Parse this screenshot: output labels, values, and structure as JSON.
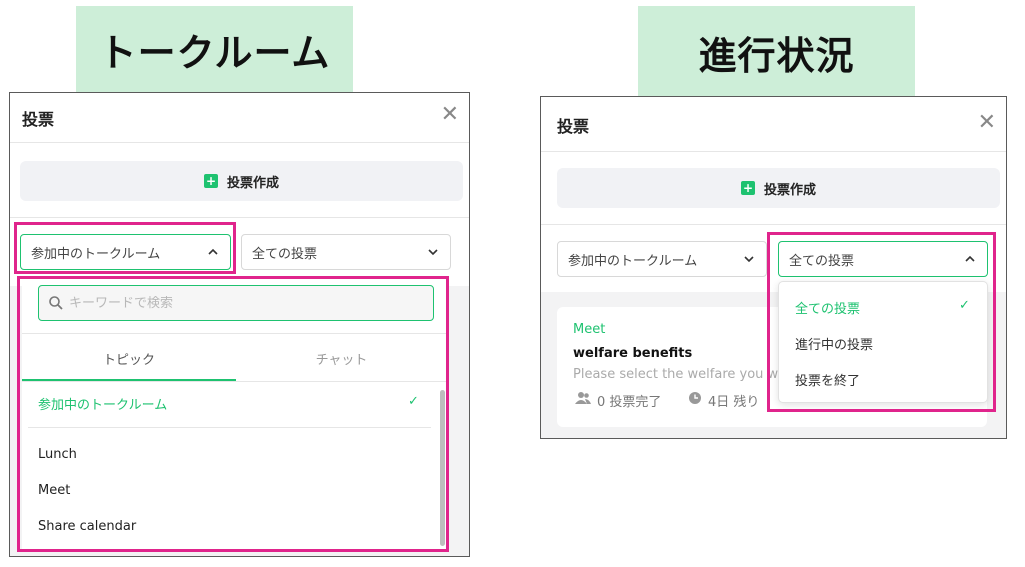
{
  "left": {
    "banner": "トークルーム",
    "panel_title": "投票",
    "create_label": "投票作成",
    "room_filter": "参加中のトークルーム",
    "vote_filter": "全ての投票",
    "search_placeholder": "キーワードで検索",
    "tabs": [
      "トピック",
      "チャット"
    ],
    "selected_item": "参加中のトークルーム",
    "items": [
      "Lunch",
      "Meet",
      "Share calendar"
    ]
  },
  "right": {
    "banner": "進行状況",
    "panel_title": "投票",
    "create_label": "投票作成",
    "room_filter": "参加中のトークルーム",
    "vote_filter": "全ての投票",
    "card": {
      "room": "Meet",
      "title": "welfare benefits",
      "desc": "Please select the welfare you wa",
      "count": "0 投票完了",
      "remaining": "4日 残り"
    },
    "menu": [
      "全ての投票",
      "進行中の投票",
      "投票を終了"
    ]
  },
  "colors": {
    "accent": "#1ec270",
    "highlight": "#e0248c",
    "banner": "#cdeed8"
  }
}
